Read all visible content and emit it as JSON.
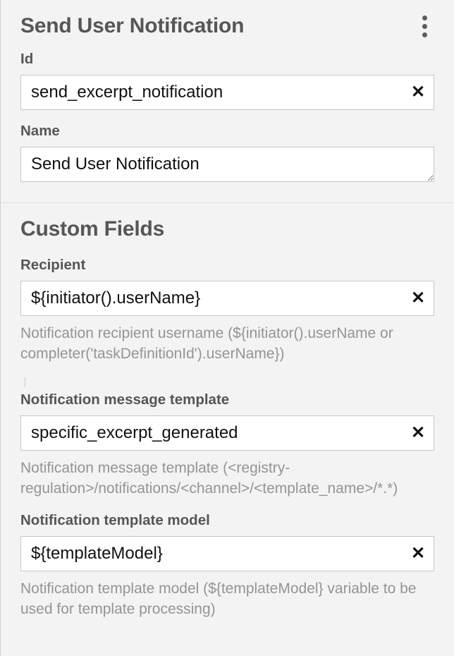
{
  "section1": {
    "title": "Send User Notification",
    "id_label": "Id",
    "id_value": "send_excerpt_notification",
    "name_label": "Name",
    "name_value": "Send User Notification"
  },
  "section2": {
    "title": "Custom Fields",
    "recipient_label": "Recipient",
    "recipient_value": "${initiator().userName}",
    "recipient_help": "Notification recipient username (${initiator().userName or completer('taskDefinitionId').userName})",
    "template_label": "Notification message template",
    "template_value": "specific_excerpt_generated",
    "template_help": "Notification message template (<registry-regulation>/notifications/<channel>/<template_name>/*.*)",
    "model_label": "Notification template model",
    "model_value": "${templateModel}",
    "model_help": "Notification template model (${templateModel} variable to be used for template processing)"
  },
  "glyph": {
    "close": "✕"
  }
}
